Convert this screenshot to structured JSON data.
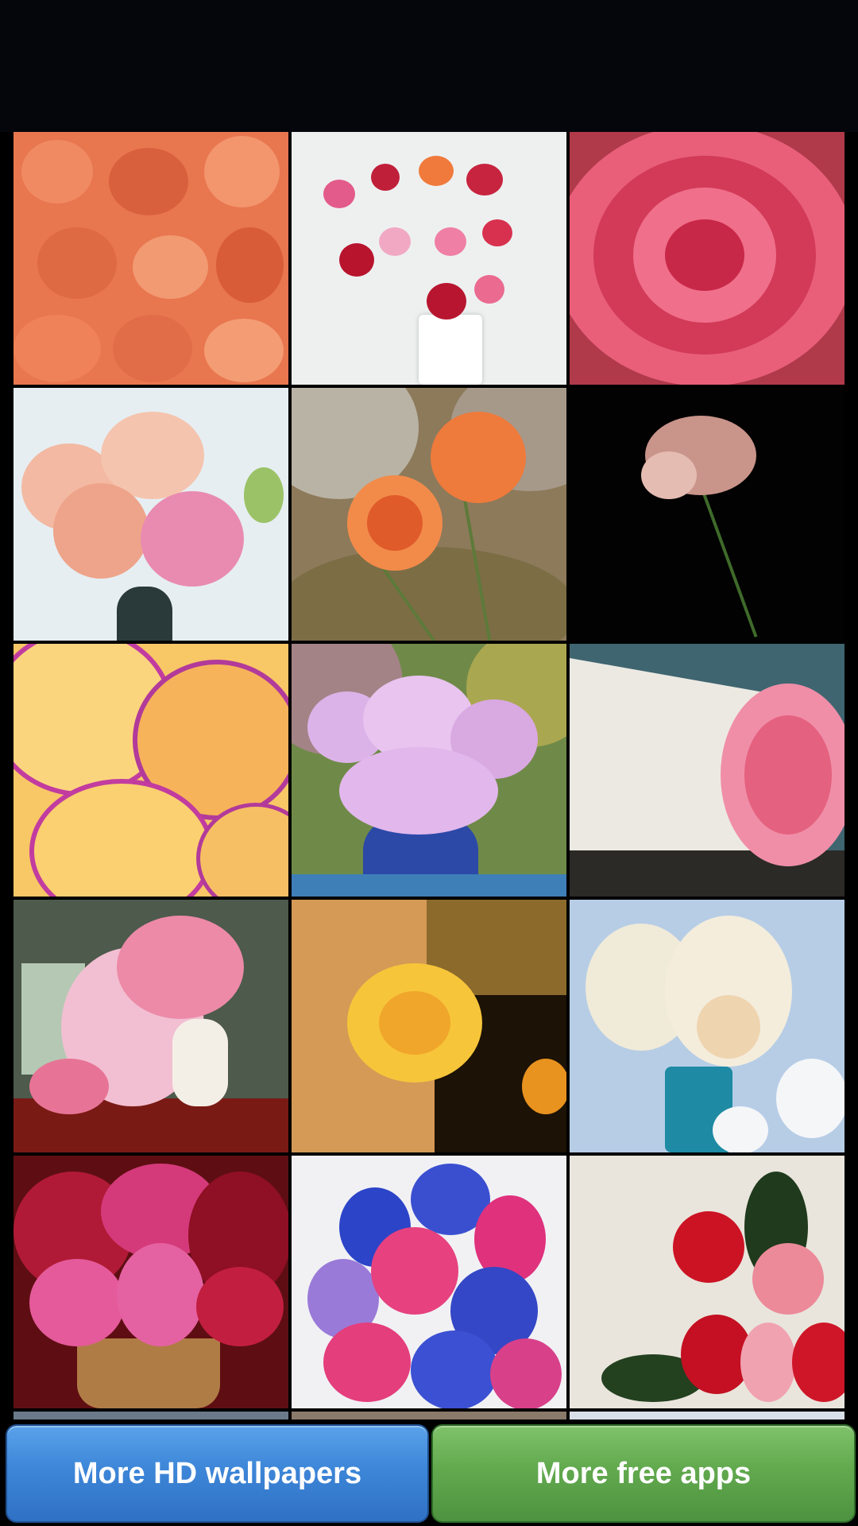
{
  "gallery": {
    "thumbnails": [
      {
        "name": "wallpaper-orange-carnations"
      },
      {
        "name": "wallpaper-carnation-bouquet-window"
      },
      {
        "name": "wallpaper-red-carnation-closeup"
      },
      {
        "name": "wallpaper-peach-pink-bouquet"
      },
      {
        "name": "wallpaper-orange-carnations-field"
      },
      {
        "name": "wallpaper-single-carnation-dark"
      },
      {
        "name": "wallpaper-yellow-purple-carnation"
      },
      {
        "name": "wallpaper-lilac-carnations-blue-vase"
      },
      {
        "name": "wallpaper-pink-carnation-book"
      },
      {
        "name": "wallpaper-pink-carnations-white-jug"
      },
      {
        "name": "wallpaper-yellow-carnation-gift"
      },
      {
        "name": "wallpaper-white-flowers-teal-vase"
      },
      {
        "name": "wallpaper-red-pink-bouquet"
      },
      {
        "name": "wallpaper-blue-pink-bouquet"
      },
      {
        "name": "wallpaper-red-carnations-ferns"
      }
    ]
  },
  "buttons": {
    "more_wallpapers": "More HD wallpapers",
    "more_apps": "More free apps"
  },
  "colors": {
    "blue_button": "#3d86d8",
    "green_button": "#62a94e",
    "background": "#000000"
  }
}
